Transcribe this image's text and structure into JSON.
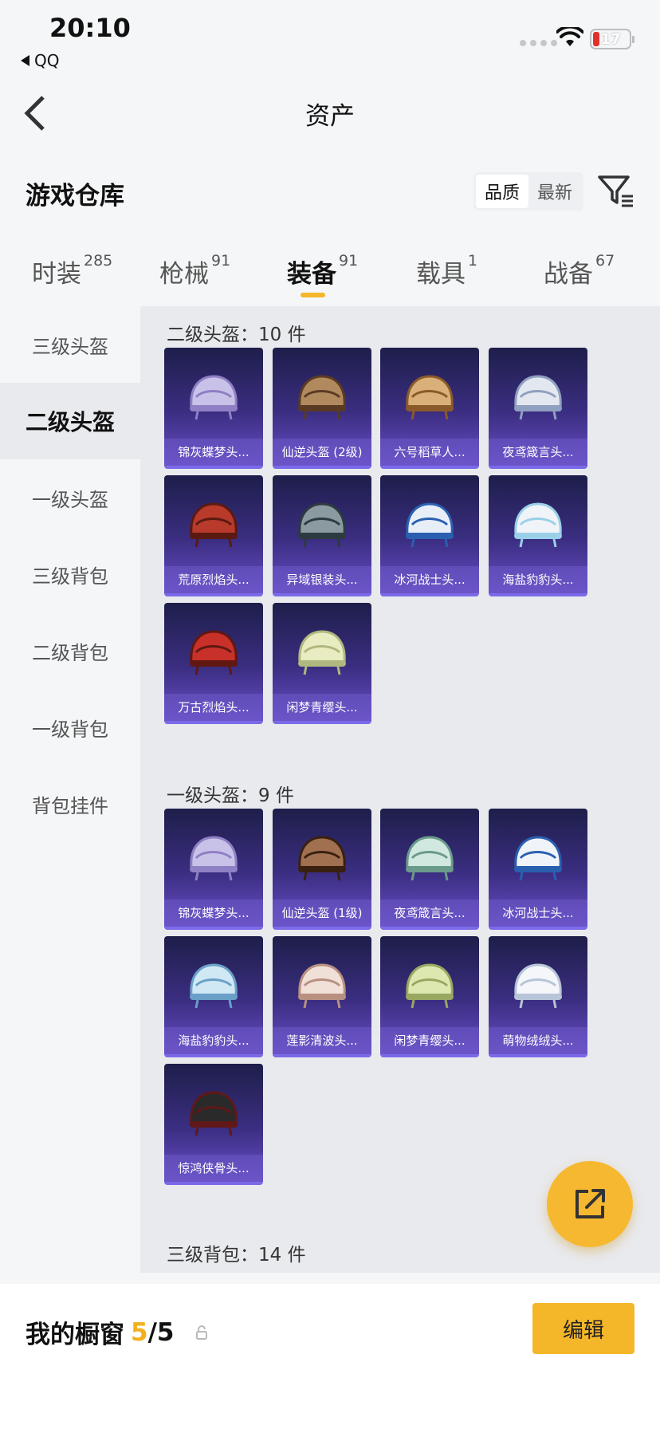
{
  "status": {
    "time": "20:10",
    "back_app": "QQ",
    "battery": "17"
  },
  "nav": {
    "title": "资产"
  },
  "header": {
    "title": "游戏仓库",
    "sort_options": [
      "品质",
      "最新"
    ]
  },
  "tabs": [
    {
      "label": "时装",
      "count": "285"
    },
    {
      "label": "枪械",
      "count": "91"
    },
    {
      "label": "装备",
      "count": "91"
    },
    {
      "label": "载具",
      "count": "1"
    },
    {
      "label": "战备",
      "count": "67"
    }
  ],
  "sidebar": [
    "三级头盔",
    "二级头盔",
    "一级头盔",
    "三级背包",
    "二级背包",
    "一级背包",
    "背包挂件"
  ],
  "groups": [
    {
      "label": "二级头盔：10 件",
      "items": [
        "锦灰蝶梦头...",
        "仙逆头盔 (2级)",
        "六号稻草人...",
        "夜鸢箴言头...",
        "荒原烈焰头...",
        "异域银装头...",
        "冰河战士头...",
        "海盐豹豹头...",
        "万古烈焰头...",
        "闲梦青缨头..."
      ]
    },
    {
      "label": "一级头盔：9 件",
      "items": [
        "锦灰蝶梦头...",
        "仙逆头盔 (1级)",
        "夜鸢箴言头...",
        "冰河战士头...",
        "海盐豹豹头...",
        "莲影清波头...",
        "闲梦青缨头...",
        "萌物绒绒头...",
        "惊鸿侠骨头..."
      ]
    },
    {
      "label": "三级背包：14 件",
      "items": []
    }
  ],
  "bottom": {
    "showcase_label": "我的橱窗",
    "showcase_count": "5",
    "showcase_total": "/5",
    "edit_label": "编辑"
  },
  "colors": {
    "accent": "#f5b72a",
    "card_bg": "#3b2e82"
  },
  "icons": {
    "back": "chevron-left-icon",
    "filter": "filter-icon",
    "share": "share-icon",
    "lock": "lock-icon"
  }
}
